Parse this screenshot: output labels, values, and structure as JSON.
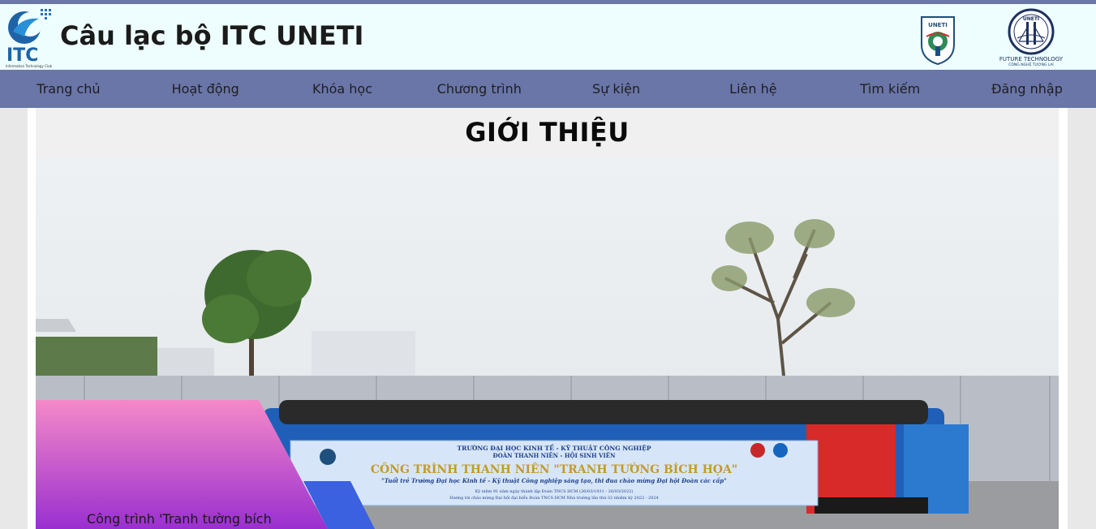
{
  "header": {
    "logo_text": "ITC",
    "logo_subtext": "Information Technology Club",
    "title": "Câu lạc bộ ITC UNETI",
    "uneti_logo_text": "UNETI",
    "ft_logo_top": "UNETI",
    "ft_logo_text": "FUTURE TECHNOLOGY",
    "ft_logo_sub": "CÔNG NGHỆ TƯƠNG LAI"
  },
  "nav": {
    "items": [
      {
        "label": "Trang chủ"
      },
      {
        "label": "Hoạt động"
      },
      {
        "label": "Khóa học"
      },
      {
        "label": "Chương trình"
      },
      {
        "label": "Sự kiện"
      },
      {
        "label": "Liên hệ"
      },
      {
        "label": "Tìm kiếm"
      },
      {
        "label": "Đăng nhập"
      }
    ]
  },
  "main": {
    "section_title": "GIỚI THIỆU",
    "slide_caption": "Công trình 'Tranh tường bích",
    "banner": {
      "line1": "TRƯỜNG ĐẠI HỌC KINH TẾ - KỸ THUẬT CÔNG NGHIỆP",
      "line2": "ĐOÀN THANH NIÊN - HỘI SINH VIÊN",
      "headline": "CÔNG TRÌNH THANH NIÊN \"TRANH TƯỜNG BÍCH HỌA\"",
      "line3": "\"Tuổi trẻ Trường Đại học Kinh tế - Kỹ thuật Công nghiệp sáng tạo, thi đua chào mừng Đại hội Đoàn các cấp\"",
      "line4": "Kỷ niệm 91 năm ngày thành lập Đoàn TNCS HCM (26/03/1931 - 26/03/2022)",
      "line5": "Hướng tới chào mừng Đại hội đại biểu Đoàn TNCS HCM Nhà trường lần thứ 32 nhiệm kỳ 2022 - 2024"
    }
  },
  "colors": {
    "nav_bg": "#6a76a8",
    "header_bg": "#eefefe",
    "section_bg": "#f0f0f0",
    "accent_pink": "#f07cc8",
    "accent_purple": "#9a2fd0",
    "accent_blue": "#3b60e0"
  }
}
